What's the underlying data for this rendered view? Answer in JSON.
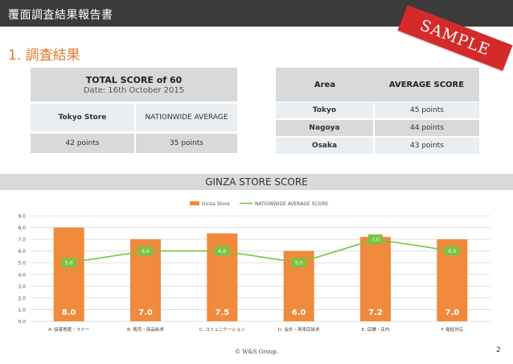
{
  "header": {
    "title": "覆面調査結果報告書"
  },
  "stamp": {
    "label": "SAMPLE"
  },
  "section": {
    "title": "1. 調査結果"
  },
  "score_table": {
    "title": "TOTAL SCORE of 60",
    "date": "Date: 16th October 2015",
    "col1": "Tokyo Store",
    "col2": "NATIONWIDE AVERAGE",
    "val1": "42 points",
    "val2": "35 points"
  },
  "area_table": {
    "header_area": "Area",
    "header_score": "AVERAGE SCORE",
    "rows": [
      {
        "area": "Tokyo",
        "score": "45 points"
      },
      {
        "area": "Nagoya",
        "score": "44 points"
      },
      {
        "area": "Osaka",
        "score": "43 points"
      }
    ]
  },
  "chart_banner": "GINZA STORE SCORE",
  "chart_data": {
    "type": "bar",
    "categories": [
      "A. 接客態度・マナー",
      "B. 販売・商品訴求",
      "C. コミュニケーション",
      "D. 会計・再来店訴求",
      "E. 店舗・店内",
      "F. 電話対応"
    ],
    "series": [
      {
        "name": "Ginza Store",
        "type": "bar",
        "color": "#f08a3c",
        "values": [
          8.0,
          7.0,
          7.5,
          6.0,
          7.2,
          7.0
        ]
      },
      {
        "name": "NATIONWIDE AVERAGE SCORE",
        "type": "line",
        "color": "#7cc242",
        "values": [
          5.0,
          6.0,
          6.0,
          5.0,
          7.0,
          6.0
        ]
      }
    ],
    "yticks": [
      "0.0",
      "1.0",
      "2.0",
      "3.0",
      "4.0",
      "5.0",
      "6.0",
      "7.0",
      "8.0",
      "9.0"
    ],
    "ylim": [
      0,
      9
    ],
    "grid": true,
    "legend": "top-center"
  },
  "footer": {
    "copyright": "© W&S Group.",
    "page": "2"
  }
}
